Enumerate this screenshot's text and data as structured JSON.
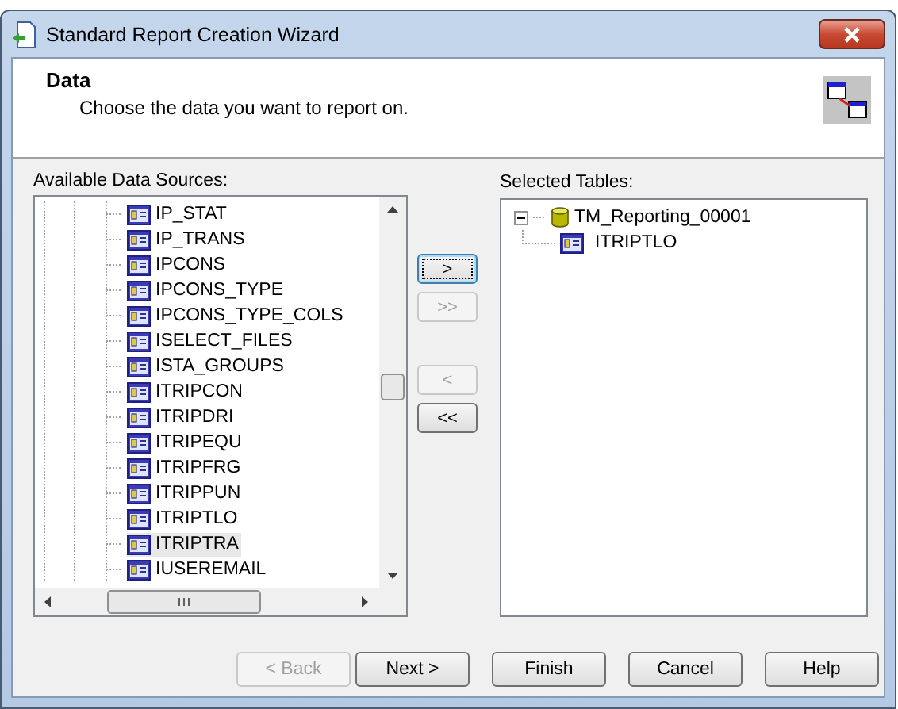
{
  "window": {
    "title": "Standard Report Creation Wizard"
  },
  "header": {
    "title": "Data",
    "subtitle": "Choose the data you want to report on."
  },
  "available": {
    "label": "Available Data Sources:",
    "items": [
      {
        "name": "IP_STAT",
        "selected": false
      },
      {
        "name": "IP_TRANS",
        "selected": false
      },
      {
        "name": "IPCONS",
        "selected": false
      },
      {
        "name": "IPCONS_TYPE",
        "selected": false
      },
      {
        "name": "IPCONS_TYPE_COLS",
        "selected": false
      },
      {
        "name": "ISELECT_FILES",
        "selected": false
      },
      {
        "name": "ISTA_GROUPS",
        "selected": false
      },
      {
        "name": "ITRIPCON",
        "selected": false
      },
      {
        "name": "ITRIPDRI",
        "selected": false
      },
      {
        "name": "ITRIPEQU",
        "selected": false
      },
      {
        "name": "ITRIPFRG",
        "selected": false
      },
      {
        "name": "ITRIPPUN",
        "selected": false
      },
      {
        "name": "ITRIPTLO",
        "selected": false
      },
      {
        "name": "ITRIPTRA",
        "selected": true
      },
      {
        "name": "IUSEREMAIL",
        "selected": false
      }
    ]
  },
  "selected_tables": {
    "label": "Selected Tables:",
    "tree": [
      {
        "name": "TM_Reporting_00001",
        "kind": "database",
        "expanded": true,
        "children": [
          {
            "name": "ITRIPTLO",
            "kind": "table"
          }
        ]
      }
    ]
  },
  "move_buttons": [
    {
      "label": ">",
      "disabled": false,
      "focused": true
    },
    {
      "label": ">>",
      "disabled": true,
      "focused": false
    },
    {
      "label": "<",
      "disabled": true,
      "focused": false
    },
    {
      "label": "<<",
      "disabled": false,
      "focused": false
    }
  ],
  "footer_buttons": [
    {
      "label": "< Back",
      "disabled": true
    },
    {
      "label": "Next >",
      "disabled": false
    },
    {
      "label": "Finish",
      "disabled": false
    },
    {
      "label": "Cancel",
      "disabled": false
    },
    {
      "label": "Help",
      "disabled": false
    }
  ]
}
